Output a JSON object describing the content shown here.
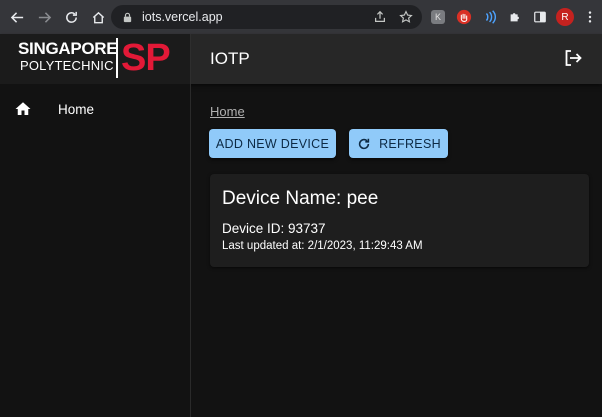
{
  "browser": {
    "url": "iots.vercel.app",
    "profile_initial": "R",
    "extension_k_label": "K"
  },
  "appbar": {
    "logo_line1": "SINGAPORE",
    "logo_line2": "POLYTECHNIC",
    "logo_mark": "SP",
    "title": "IOTP",
    "logo_mark_color": "#e31937"
  },
  "sidebar": {
    "items": [
      {
        "label": "Home",
        "icon": "home-icon"
      }
    ]
  },
  "main": {
    "breadcrumb": "Home",
    "add_button": "ADD NEW DEVICE",
    "refresh_button": "REFRESH",
    "accent_color": "#90caf9",
    "device": {
      "name": "Device Name: pee",
      "id": "Device ID: 93737",
      "updated": "Last updated at: 2/1/2023, 11:29:43 AM"
    }
  }
}
